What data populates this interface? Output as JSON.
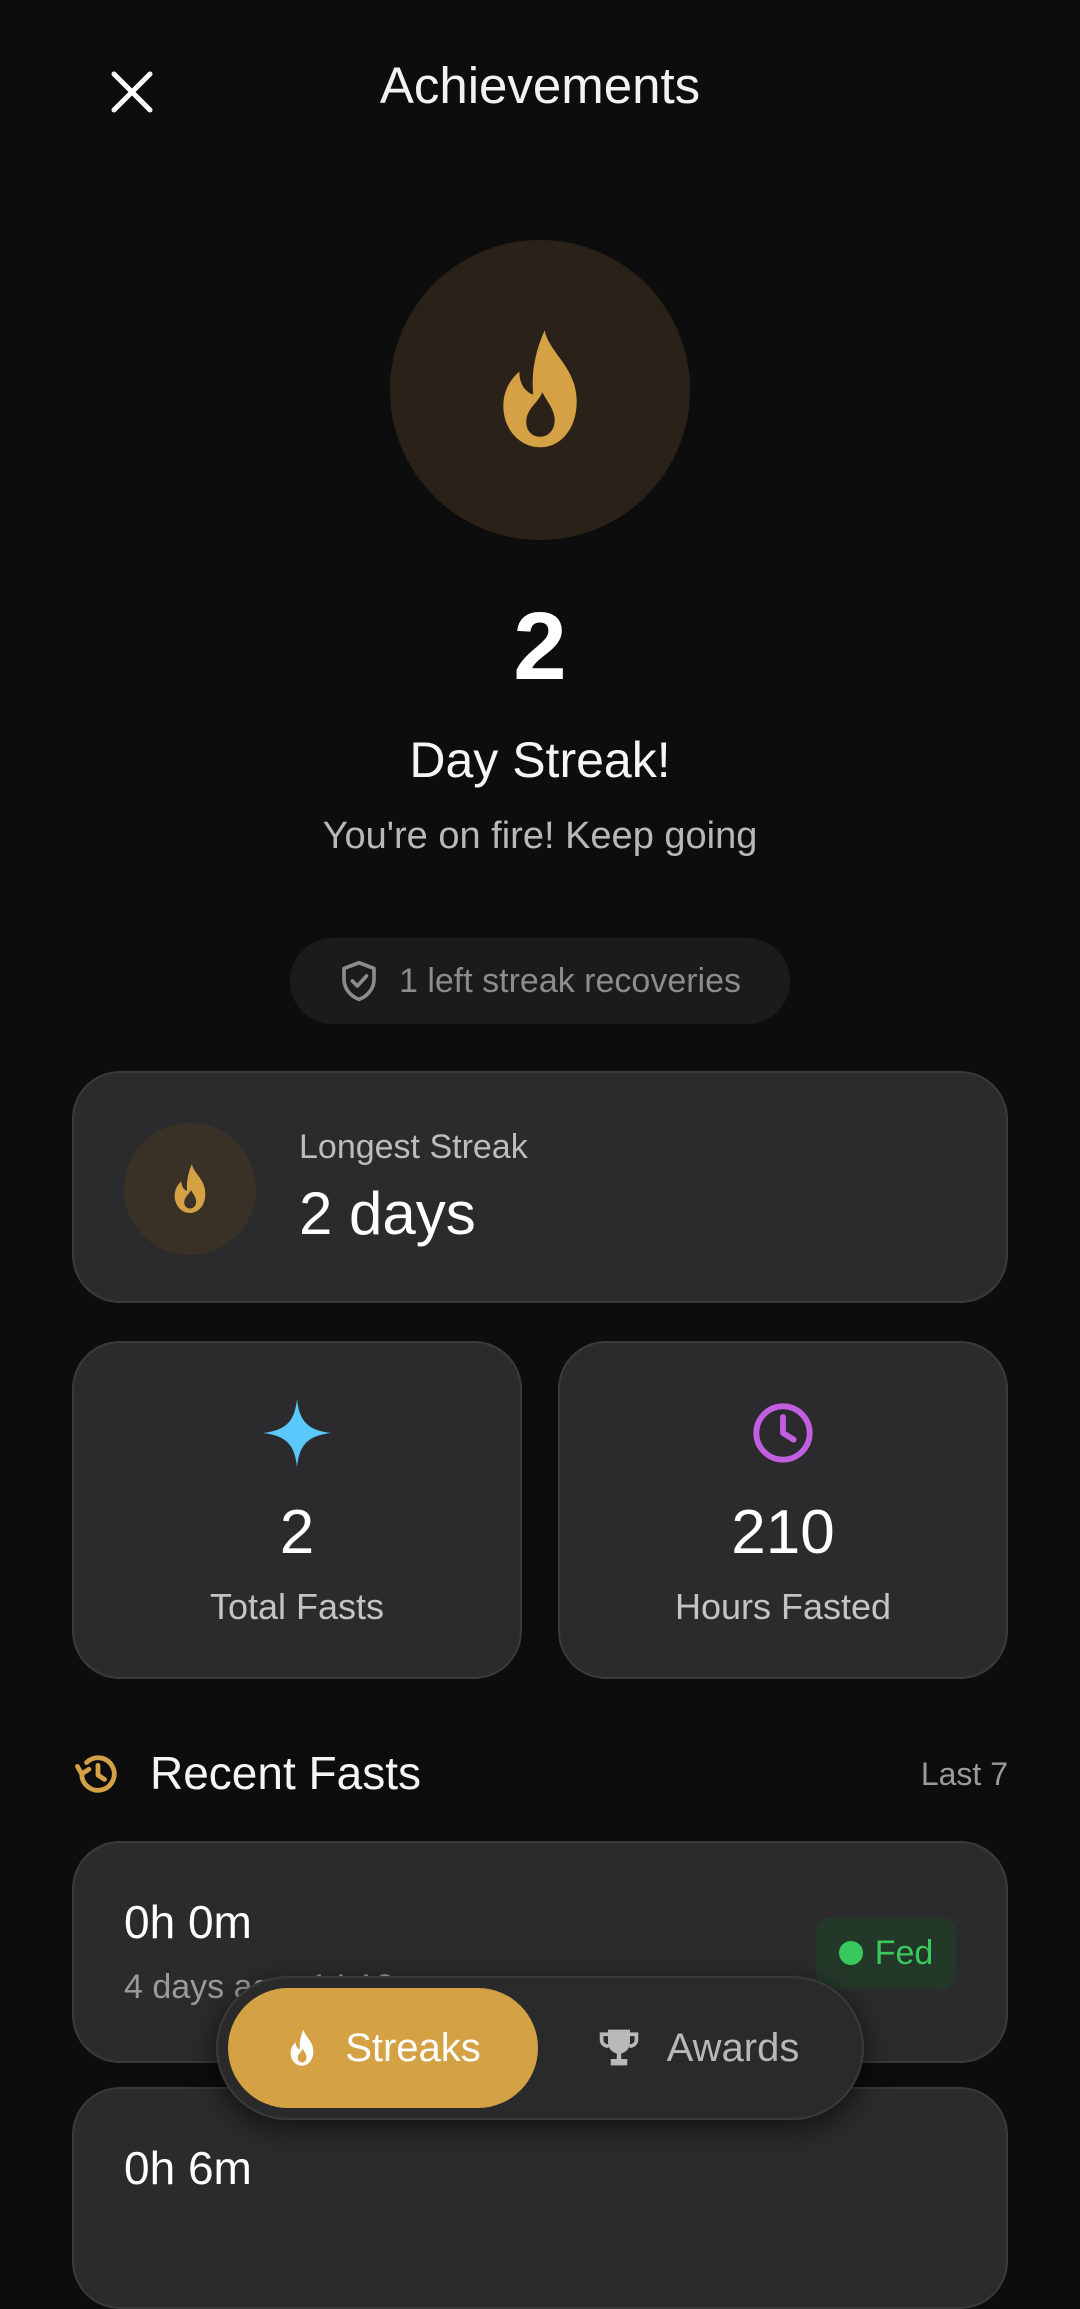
{
  "header": {
    "title": "Achievements",
    "close_icon": "close-icon"
  },
  "hero": {
    "icon": "flame-icon",
    "streak_count": "2",
    "streak_label": "Day Streak!",
    "subtitle": "You're on fire! Keep going"
  },
  "recovery": {
    "icon": "shield-check-icon",
    "text": "1 left streak recoveries"
  },
  "longest_streak": {
    "icon": "flame-icon",
    "label": "Longest Streak",
    "value": "2 days"
  },
  "stats": [
    {
      "icon": "sparkle-icon",
      "value": "2",
      "label": "Total Fasts",
      "color": "#5ac8fa"
    },
    {
      "icon": "clock-icon",
      "value": "210",
      "label": "Hours Fasted",
      "color": "#c25ee0"
    }
  ],
  "recent": {
    "icon": "history-icon",
    "title": "Recent Fasts",
    "range": "Last 7",
    "items": [
      {
        "duration": "0h 0m",
        "date": "4 days ago, 14:18",
        "badge": "Fed"
      },
      {
        "duration": "0h 6m",
        "date": "",
        "badge": ""
      }
    ]
  },
  "tabs": [
    {
      "label": "Streaks",
      "icon": "flame-icon",
      "active": true
    },
    {
      "label": "Awards",
      "icon": "trophy-icon",
      "active": false
    }
  ],
  "colors": {
    "background": "#0d0d0d",
    "card": "#2b2b2d",
    "accent": "#d4a245",
    "fed_green": "#38c95c"
  }
}
